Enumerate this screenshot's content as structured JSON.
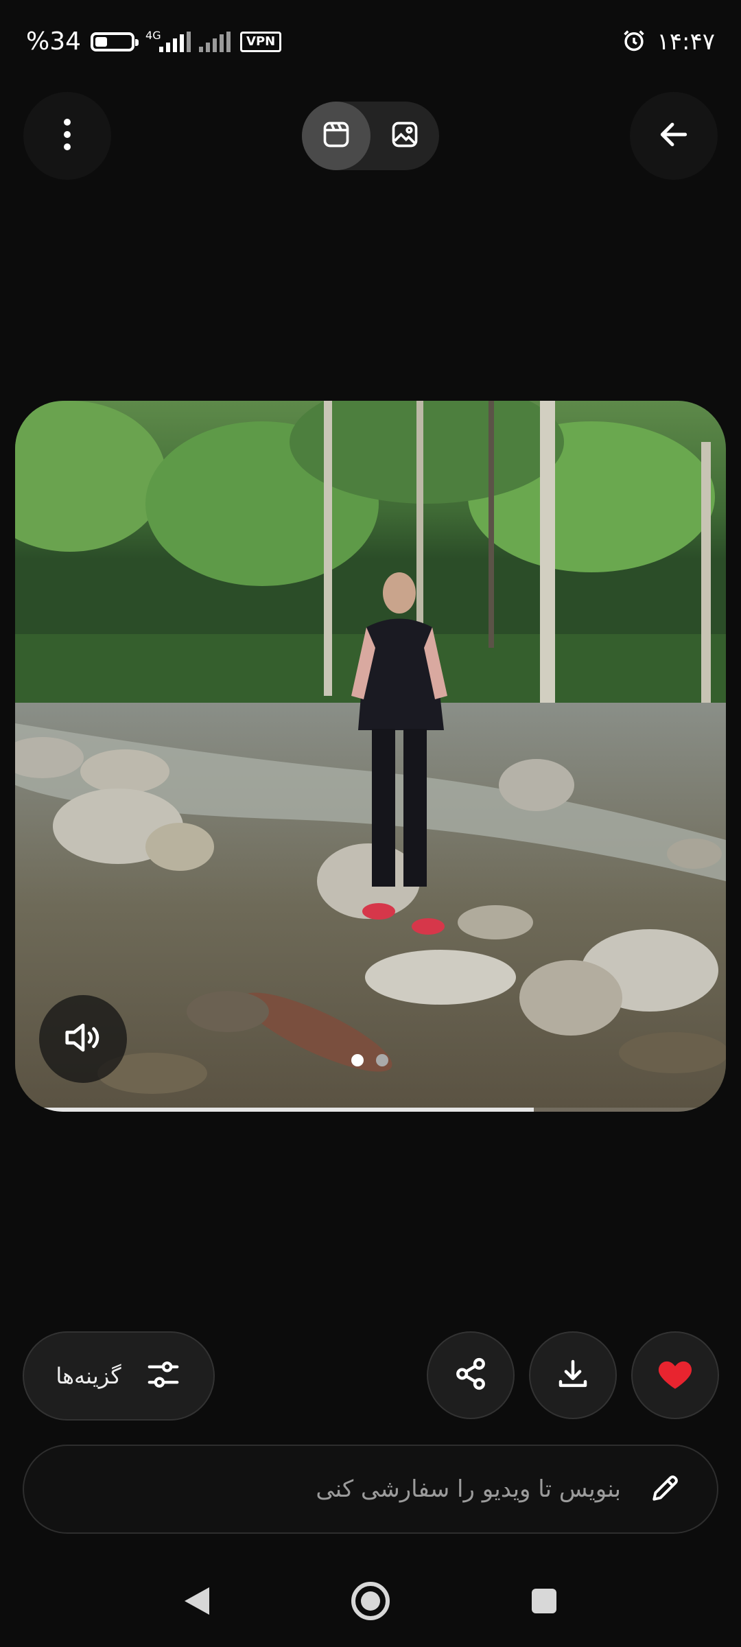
{
  "status_bar": {
    "battery_percent": "%34",
    "battery_level": 0.34,
    "network": "4G",
    "vpn": "VPN",
    "time": "۱۴:۴۷"
  },
  "header": {
    "menu_icon": "more-vert-icon",
    "toggle": [
      {
        "name": "video-icon",
        "active": true
      },
      {
        "name": "image-icon",
        "active": false
      }
    ],
    "back_icon": "arrow-back-icon"
  },
  "media": {
    "mute_icon": "volume-icon",
    "page_count": 2,
    "current_page": 1,
    "progress": 0.73
  },
  "actions": {
    "options_label": "گزینه‌ها",
    "options_icon": "sliders-icon",
    "share_icon": "share-icon",
    "download_icon": "download-icon",
    "like_icon": "heart-icon",
    "like_color": "#e8242f"
  },
  "prompt": {
    "placeholder": "بنویس تا ویدیو را سفارشی کنی",
    "icon": "pencil-icon"
  },
  "nav": [
    "back-icon",
    "home-icon",
    "recents-icon"
  ]
}
